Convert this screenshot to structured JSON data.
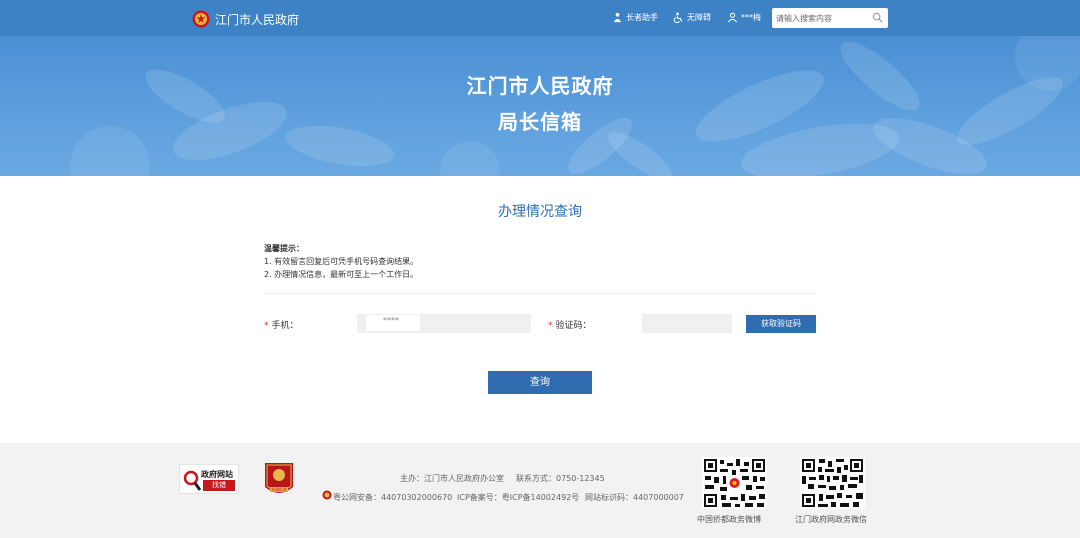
{
  "header": {
    "site_name": "江门市人民政府",
    "tools": [
      {
        "label": "长者助手",
        "icon": "elderly-icon"
      },
      {
        "label": "无障碍",
        "icon": "accessibility-icon"
      },
      {
        "label": "***梅",
        "icon": "user-icon"
      }
    ],
    "search": {
      "placeholder": "请输入搜索内容"
    }
  },
  "banner": {
    "title_line1": "江门市人民政府",
    "title_line2": "局长信箱"
  },
  "main": {
    "section_title": "办理情况查询",
    "tips_heading": "温馨提示：",
    "tips": [
      "1. 有效留言回复后可凭手机号码查询结果。",
      "2. 办理情况信息，最新可至上一个工作日。"
    ],
    "form": {
      "phone_label": "手机：",
      "phone_value": "****",
      "code_label": "验证码：",
      "get_code_button": "获取验证码",
      "required_mark": "*"
    },
    "query_button": "查询"
  },
  "footer": {
    "badge1_top": "政府网站",
    "badge1_bottom": "找错",
    "badge2_label": "党政机关",
    "sponsor": "主办：江门市人民政府办公室",
    "contact": "联系方式：0750-12345",
    "police_record": "粤公网安备：44070302000670",
    "icp": "ICP备案号：粤ICP备14002492号",
    "site_code": "网站标识码：4407000007",
    "qr1_caption": "中国侨都政务微博",
    "qr2_caption": "江门政府网政务微信"
  },
  "colors": {
    "topbar": "#3e82c6",
    "accent": "#2f6db0",
    "required": "#d9301f",
    "footer_bg": "#f2f2f2"
  }
}
